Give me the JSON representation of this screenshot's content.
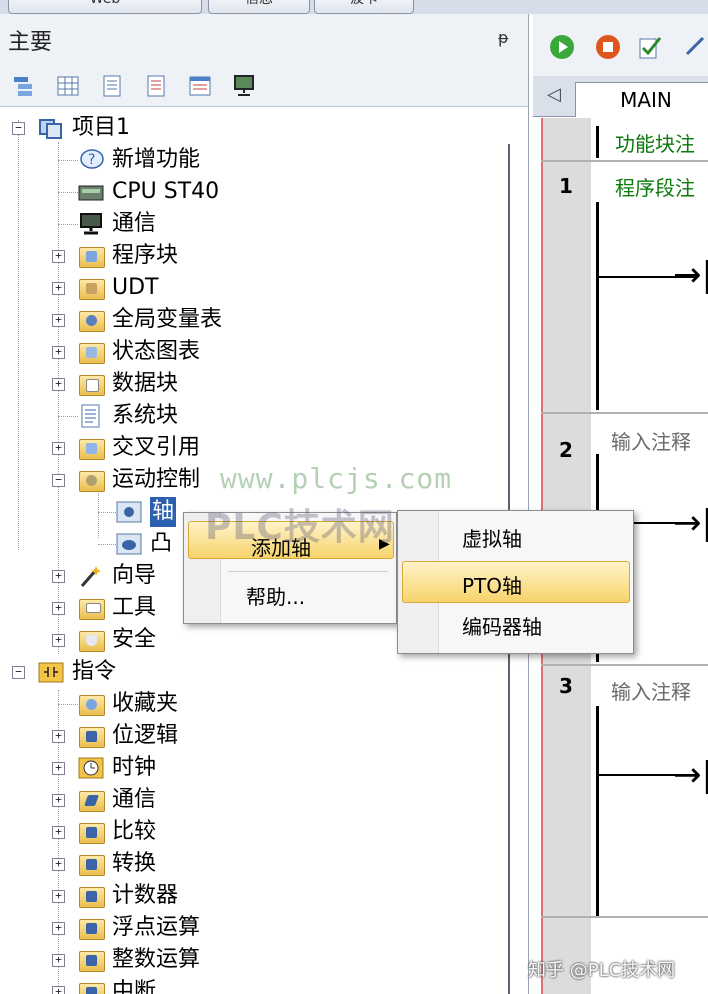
{
  "top_tabs": [
    "Web",
    "信息",
    "波卡"
  ],
  "left_panel": {
    "title": "主要",
    "pin_glyph": "ᵽ",
    "tree": [
      {
        "label": "项目1",
        "icon": "project-icon",
        "expander": "−"
      },
      {
        "label": "新增功能",
        "icon": "help-bubble-icon"
      },
      {
        "label": "CPU ST40",
        "icon": "cpu-icon"
      },
      {
        "label": "通信",
        "icon": "monitor-icon"
      },
      {
        "label": "程序块",
        "icon": "folder-icon",
        "expander": "+"
      },
      {
        "label": "UDT",
        "icon": "folder-icon",
        "expander": "+"
      },
      {
        "label": "全局变量表",
        "icon": "folder-icon",
        "expander": "+"
      },
      {
        "label": "状态图表",
        "icon": "folder-icon",
        "expander": "+"
      },
      {
        "label": "数据块",
        "icon": "folder-icon",
        "expander": "+"
      },
      {
        "label": "系统块",
        "icon": "document-icon"
      },
      {
        "label": "交叉引用",
        "icon": "folder-icon",
        "expander": "+"
      },
      {
        "label": "运动控制",
        "icon": "folder-icon",
        "expander": "−"
      },
      {
        "label": "轴",
        "icon": "axis-gear-icon",
        "selected": true
      },
      {
        "label": "凸",
        "icon": "cam-icon"
      },
      {
        "label": "向导",
        "icon": "wand-icon",
        "expander": "+"
      },
      {
        "label": "工具",
        "icon": "folder-icon",
        "expander": "+"
      },
      {
        "label": "安全",
        "icon": "folder-icon",
        "expander": "+"
      },
      {
        "label": "指令",
        "icon": "instruction-icon",
        "expander": "−"
      },
      {
        "label": "收藏夹",
        "icon": "folder-icon"
      },
      {
        "label": "位逻辑",
        "icon": "folder-icon",
        "expander": "+"
      },
      {
        "label": "时钟",
        "icon": "clock-icon",
        "expander": "+"
      },
      {
        "label": "通信",
        "icon": "folder-icon",
        "expander": "+"
      },
      {
        "label": "比较",
        "icon": "folder-icon",
        "expander": "+"
      },
      {
        "label": "转换",
        "icon": "folder-icon",
        "expander": "+"
      },
      {
        "label": "计数器",
        "icon": "folder-icon",
        "expander": "+"
      },
      {
        "label": "浮点运算",
        "icon": "folder-icon",
        "expander": "+"
      },
      {
        "label": "整数运算",
        "icon": "folder-icon",
        "expander": "+"
      },
      {
        "label": "中断",
        "icon": "folder-icon",
        "expander": "+"
      }
    ]
  },
  "editor": {
    "tab": "MAIN",
    "networks": [
      {
        "number": "",
        "comment": "功能块注"
      },
      {
        "number": "1",
        "comment": "程序段注"
      },
      {
        "number": "2",
        "comment": "输入注释"
      },
      {
        "number": "3",
        "comment": "输入注释"
      }
    ],
    "coil_glyph": "→|"
  },
  "context_menu": {
    "items": [
      {
        "label": "添加轴",
        "submenu_arrow": "▶"
      },
      {
        "label": "帮助..."
      }
    ]
  },
  "submenu": {
    "items": [
      "虚拟轴",
      "PTO轴",
      "编码器轴"
    ]
  },
  "watermarks": {
    "url": "www.plcjs.com",
    "brand": "PLC技术网",
    "footer": "知乎 @PLC技术网"
  }
}
